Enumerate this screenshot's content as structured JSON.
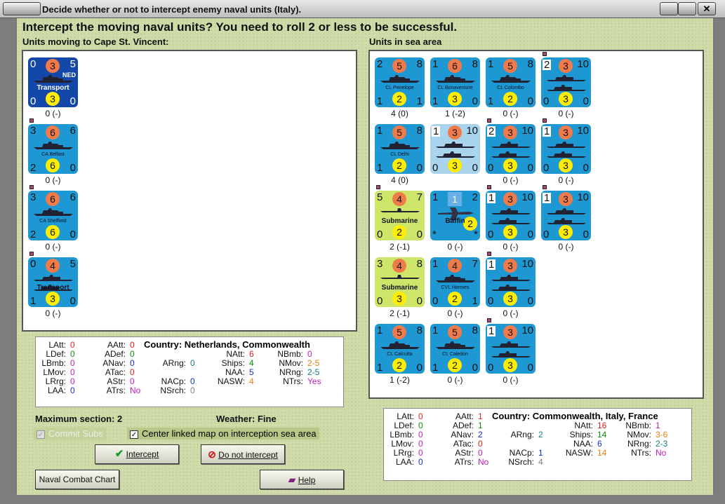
{
  "window": {
    "title": "Decide whether or not to intercept enemy naval units (Italy).",
    "close": "✕"
  },
  "headline": "Intercept the moving naval units?  You need to roll 2 or less to be successful.",
  "left": {
    "heading": "Units moving to Cape St. Vincent:",
    "units": [
      {
        "tl": "0",
        "att": "3",
        "tr": "5",
        "nation": "NED",
        "name": "Transport",
        "bl": "0",
        "def": "3",
        "br": "0",
        "cap": "0 (-)"
      },
      {
        "tl": "3",
        "att": "6",
        "tr": "6",
        "name": "CA Belfast",
        "bl": "2",
        "def": "6",
        "br": "0",
        "cap": "0 (-)"
      },
      {
        "tl": "3",
        "att": "6",
        "tr": "6",
        "name": "CA Sheffield",
        "bl": "2",
        "def": "6",
        "br": "0",
        "cap": "0 (-)"
      },
      {
        "tl": "0",
        "att": "4",
        "tr": "5",
        "name": "Transport",
        "bl": "1",
        "def": "3",
        "br": "0",
        "cap": "0 (-)"
      }
    ]
  },
  "right": {
    "heading": "Units in sea area",
    "units": [
      {
        "tl": "2",
        "att": "5",
        "tr": "8",
        "name": "CL Penelope",
        "bl": "1",
        "def": "2",
        "br": "1",
        "cap": "4 (0)"
      },
      {
        "tl": "1",
        "att": "6",
        "tr": "8",
        "name": "CL Bonaventure",
        "bl": "1",
        "def": "3",
        "br": "0",
        "cap": "1 (-2)"
      },
      {
        "tl": "1",
        "att": "5",
        "tr": "8",
        "name": "CL Colombo",
        "bl": "1",
        "def": "2",
        "br": "0",
        "cap": "0 (-)"
      },
      {
        "tl": "2",
        "att": "3",
        "tr": "10",
        "name": "",
        "bl": "0",
        "def": "3",
        "br": "0",
        "cap": "0 (-)"
      },
      {
        "tl": "1",
        "att": "5",
        "tr": "8",
        "name": "CL Delhi",
        "bl": "1",
        "def": "2",
        "br": "0",
        "cap": "4 (0)"
      },
      {
        "tl": "1",
        "att": "3",
        "tr": "10",
        "name": "",
        "bl": "0",
        "def": "3",
        "br": "0",
        "cap": ""
      },
      {
        "tl": "2",
        "att": "3",
        "tr": "10",
        "name": "",
        "bl": "0",
        "def": "3",
        "br": "0",
        "cap": "0 (-)"
      },
      {
        "tl": "1",
        "att": "3",
        "tr": "10",
        "name": "",
        "bl": "0",
        "def": "3",
        "br": "0",
        "cap": "0 (-)"
      },
      {
        "tl": "5",
        "att": "4",
        "tr": "7",
        "name": "Submarine",
        "bl": "0",
        "def": "2",
        "br": "0",
        "cap": "2 (-1)"
      },
      {
        "tl": "1",
        "att": "1",
        "tr": "2",
        "name": "Baffin",
        "bl": "*",
        "def": "2",
        "br": "*",
        "cap": "0 (-)"
      },
      {
        "tl": "1",
        "att": "3",
        "tr": "10",
        "name": "",
        "bl": "0",
        "def": "3",
        "br": "0",
        "cap": "0 (-)"
      },
      {
        "tl": "1",
        "att": "3",
        "tr": "10",
        "name": "",
        "bl": "0",
        "def": "3",
        "br": "0",
        "cap": "0 (-)"
      },
      {
        "tl": "3",
        "att": "4",
        "tr": "8",
        "name": "Submarine",
        "bl": "0",
        "def": "3",
        "br": "0",
        "cap": "2 (-1)"
      },
      {
        "tl": "1",
        "att": "4",
        "tr": "7",
        "name": "CVL Hermes",
        "bl": "0",
        "def": "2",
        "br": "1",
        "cap": "0 (-)"
      },
      {
        "tl": "1",
        "att": "3",
        "tr": "10",
        "name": "",
        "bl": "0",
        "def": "3",
        "br": "0",
        "cap": "0 (-)"
      },
      {
        "tl": "1",
        "att": "5",
        "tr": "8",
        "name": "CL Calcutta",
        "bl": "1",
        "def": "2",
        "br": "0",
        "cap": "1 (-2)"
      },
      {
        "tl": "1",
        "att": "5",
        "tr": "8",
        "name": "CL Caledon",
        "bl": "1",
        "def": "2",
        "br": "0",
        "cap": "0 (-)"
      },
      {
        "tl": "1",
        "att": "3",
        "tr": "10",
        "name": "",
        "bl": "0",
        "def": "3",
        "br": "0",
        "cap": "0 (-)"
      }
    ]
  },
  "stats_left": {
    "country": "Country: Netherlands, Commonwealth",
    "items": [
      [
        "LAtt:",
        "0"
      ],
      [
        "LDef:",
        "0"
      ],
      [
        "LBmb:",
        "0"
      ],
      [
        "LMov:",
        "0"
      ],
      [
        "LRrg:",
        "0"
      ],
      [
        "LAA:",
        "0"
      ],
      [
        "AAtt:",
        "0"
      ],
      [
        "ADef:",
        "0"
      ],
      [
        "ANav:",
        "0"
      ],
      [
        "ATac:",
        "0"
      ],
      [
        "AStr:",
        "0"
      ],
      [
        "ATrs:",
        "No"
      ],
      [
        "ARng:",
        "0"
      ],
      [
        "NACp:",
        "0"
      ],
      [
        "NSrch:",
        "0"
      ],
      [
        "NAtt:",
        "6"
      ],
      [
        "Ships:",
        "4"
      ],
      [
        "NAA:",
        "5"
      ],
      [
        "NASW:",
        "4"
      ],
      [
        "NBmb:",
        "0"
      ],
      [
        "NMov:",
        "2-5"
      ],
      [
        "NRng:",
        "2-5"
      ],
      [
        "NTrs:",
        "Yes"
      ]
    ]
  },
  "stats_right": {
    "country": "Country: Commonwealth, Italy, France",
    "items": [
      [
        "LAtt:",
        "0"
      ],
      [
        "LDef:",
        "0"
      ],
      [
        "LBmb:",
        "0"
      ],
      [
        "LMov:",
        "0"
      ],
      [
        "LRrg:",
        "0"
      ],
      [
        "LAA:",
        "0"
      ],
      [
        "AAtt:",
        "1"
      ],
      [
        "ADef:",
        "1"
      ],
      [
        "ANav:",
        "2"
      ],
      [
        "ATac:",
        "0"
      ],
      [
        "AStr:",
        "0"
      ],
      [
        "ATrs:",
        "No"
      ],
      [
        "ARng:",
        "2"
      ],
      [
        "NACp:",
        "1"
      ],
      [
        "NSrch:",
        "4"
      ],
      [
        "NAtt:",
        "16"
      ],
      [
        "Ships:",
        "14"
      ],
      [
        "NAA:",
        "6"
      ],
      [
        "NASW:",
        "14"
      ],
      [
        "NBmb:",
        "1"
      ],
      [
        "NMov:",
        "3-6"
      ],
      [
        "NRng:",
        "2-3"
      ],
      [
        "NTrs:",
        "No"
      ]
    ]
  },
  "colors": {
    "red": "#e02020",
    "green": "#108a10",
    "blue": "#1030c0",
    "purple": "#c020c0",
    "teal": "#108080",
    "orange": "#e08010",
    "gray": "#808080"
  },
  "max_section": "Maximum section: 2",
  "weather": "Weather:  Fine",
  "commit_subs": "Commit Subs",
  "center_map": "Center linked map on interception sea area",
  "buttons": {
    "intercept": "Intercept",
    "no_intercept": "Do not intercept",
    "chart": "Naval Combat Chart",
    "help": "Help"
  }
}
